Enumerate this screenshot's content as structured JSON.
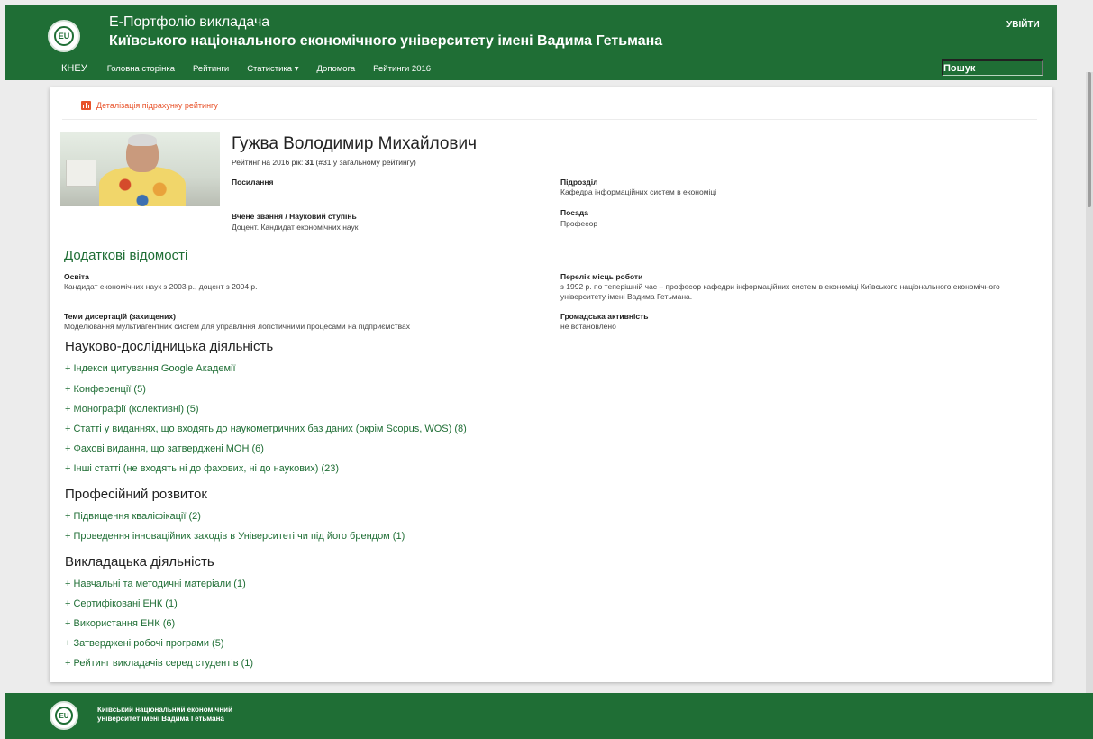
{
  "header": {
    "logo_text": "EU",
    "title_line1": "Е-Портфоліо викладача",
    "title_line2": "Київського національного економічного університету імені Вадима Гетьмана",
    "login": "УВІЙТИ",
    "nav": [
      "КНЕУ",
      "Головна сторінка",
      "Рейтинги",
      "Статистика ▾",
      "Допомога",
      "Рейтинги 2016"
    ],
    "search_placeholder": "Пошук"
  },
  "card": {
    "detail_link": "Деталізація підрахунку рейтингу",
    "name": "Гужва Володимир Михайлович",
    "rating_prefix": "Рейтинг на 2016 рік: ",
    "rating_value": "31",
    "rating_suffix": " (#31 у загальному рейтингу)",
    "links_label": "Посилання",
    "department_label": "Підрозділ",
    "department_value": "Кафедра інформаційних систем в економіці",
    "academic_label": "Вчене звання / Науковий ступінь",
    "academic_value": "Доцент. Кандидат економічних наук",
    "position_label": "Посада",
    "position_value": "Професор",
    "additional_title": "Додаткові відомості",
    "education_label": "Освіта",
    "education_value": "Кандидат економічних наук з 2003 р., доцент з 2004 р.",
    "workplaces_label": "Перелік місць роботи",
    "workplaces_value": "з 1992 р. по теперішній час – професор кафедри інформаційних систем в економіці Київського національного економічного університету імені Вадима Гетьмана.",
    "thesis_label": "Теми дисертацій (захищених)",
    "thesis_value": "Моделювання мультиагентних систем для управління логістичними процесами на підприємствах",
    "public_label": "Громадська активність",
    "public_value": "не встановлено",
    "research_title": "Науково-дослідницька діяльність",
    "research_items": [
      "+ Індекси цитування Google Академії",
      "+ Конференції (5)",
      "+ Монографії (колективні) (5)",
      "+ Статті у виданнях, що входять до наукометричних баз даних (окрім Scopus, WOS) (8)",
      "+ Фахові видання, що затверджені МОН (6)",
      "+ Інші статті (не входять ні до фахових, ні до наукових) (23)"
    ],
    "professional_title": "Професійний розвиток",
    "professional_items": [
      "+ Підвищення кваліфікації (2)",
      "+ Проведення інноваційних заходів в Університеті чи під його брендом (1)"
    ],
    "teaching_title": "Викладацька діяльність",
    "teaching_items": [
      "+ Навчальні та методичні матеріали (1)",
      "+ Сертифіковані ЕНК (1)",
      "+ Використання ЕНК (6)",
      "+ Затверджені робочі програми (5)",
      "+ Рейтинг викладачів серед студентів (1)"
    ]
  },
  "footer": {
    "logo_text": "EU",
    "line1": "Київський національний економічний",
    "line2": "університет імені Вадима Гетьмана"
  },
  "colors": {
    "brand_green": "#1f6e35",
    "accent_orange": "#e8532b"
  }
}
